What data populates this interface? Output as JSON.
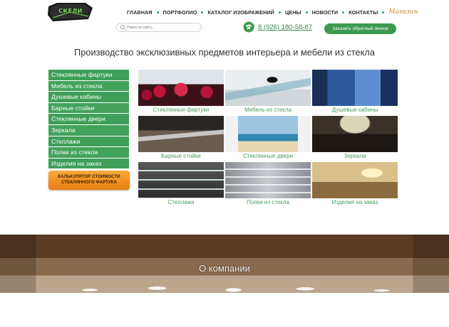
{
  "logo": {
    "text": "СКЕЛИ"
  },
  "nav": {
    "items": [
      "ГЛАВНАЯ",
      "ПОРТФОЛИО",
      "КАТАЛОГ ИЗОБРАЖЕНИЙ",
      "ЦЕНЫ",
      "НОВОСТИ",
      "КОНТАКТЫ"
    ],
    "shop": "Магазин"
  },
  "search": {
    "placeholder": "Поиск по сайту..."
  },
  "contact": {
    "phone": "8 (926) 180-58-87",
    "callback_label": "Заказать обратный звонок"
  },
  "page_title": "Производство эксклюзивных предметов интерьера и мебели из стекла",
  "sidebar": {
    "items": [
      "Стеклянные фартуки",
      "Мебель из стекла",
      "Душевые кабины",
      "Барные стойки",
      "Стеклянные двери",
      "Зеркала",
      "Стеллажи",
      "Полки из стекла",
      "Изделия на заказ"
    ],
    "calc_line1": "КАЛЬКУЛЯТОР СТОИМОСТИ",
    "calc_line2": "СТЕКЛЯННОГО ФАРТУКА"
  },
  "grid": {
    "tiles": [
      "Стеклянные фартуки",
      "Мебель из стекла",
      "Душевые кабины",
      "Барные стойки",
      "Стеклянные двери",
      "Зеркала",
      "Стеллажи",
      "Полки из стекла",
      "Изделия на заказ"
    ]
  },
  "banner": {
    "title": "О компании"
  },
  "colors": {
    "brand_green": "#43a25a",
    "accent_orange": "#f39a2b"
  }
}
